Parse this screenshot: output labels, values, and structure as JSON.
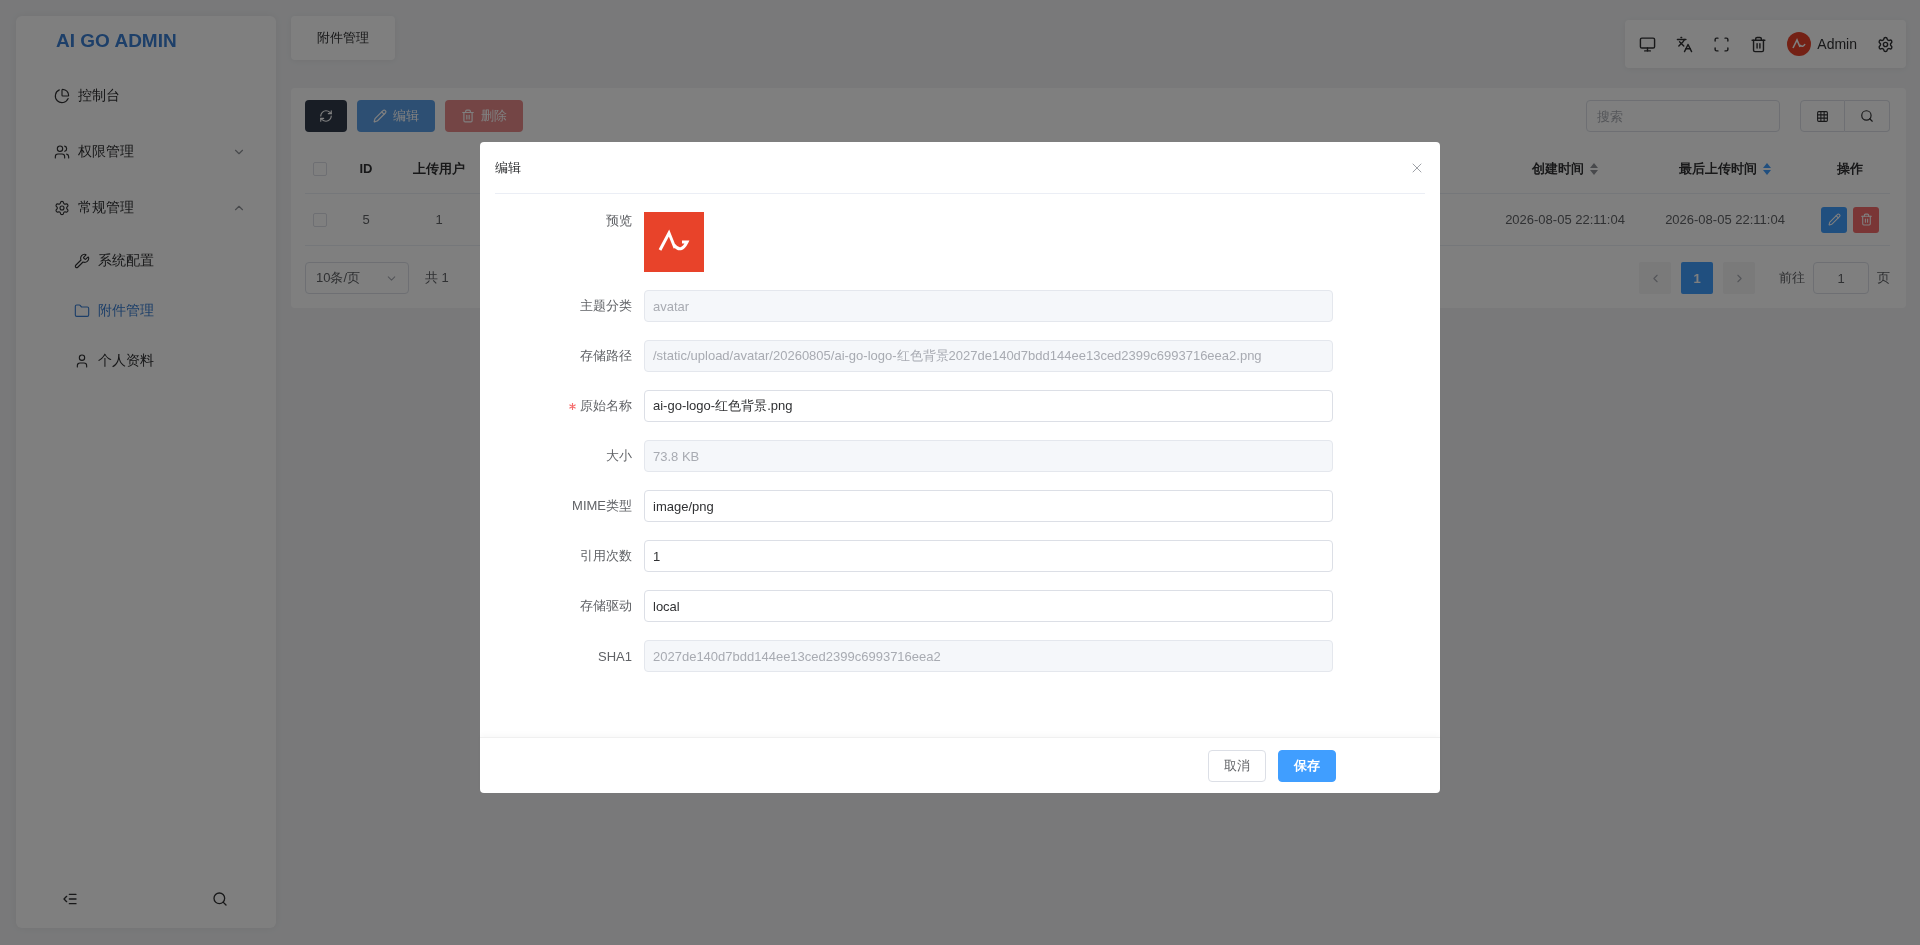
{
  "sidebar": {
    "brand": "AI GO ADMIN",
    "items": [
      {
        "label": "控制台",
        "selected": false
      },
      {
        "label": "权限管理",
        "expanded": false
      },
      {
        "label": "常规管理",
        "expanded": true,
        "children": [
          {
            "label": "系统配置",
            "selected": false
          },
          {
            "label": "附件管理",
            "selected": true
          },
          {
            "label": "个人资料",
            "selected": false
          }
        ]
      }
    ]
  },
  "tabs": [
    {
      "label": "附件管理",
      "selected": true
    }
  ],
  "header": {
    "user": "Admin"
  },
  "toolbar": {
    "buttons": [
      {
        "kind": "refresh",
        "disabled": false
      },
      {
        "kind": "edit",
        "label": "编辑",
        "disabled": true
      },
      {
        "kind": "delete",
        "label": "删除",
        "disabled": true
      }
    ],
    "search": {
      "placeholder": "搜索"
    }
  },
  "table": {
    "columns": [
      {
        "label": "ID"
      },
      {
        "label": "上传用户"
      },
      {
        "label": "创建时间",
        "sorted": false
      },
      {
        "label": "最后上传时间",
        "sorted": true
      },
      {
        "label": "操作"
      }
    ],
    "header_checked": false,
    "rows": [
      {
        "checked": false,
        "cells": [
          "5",
          "1",
          "2026-08-05 22:11:04",
          "2026-08-05 22:11:04"
        ]
      }
    ]
  },
  "pagination": {
    "page_size": "10条/页",
    "total": "共 1",
    "pages": [
      {
        "label": "1",
        "selected": true
      }
    ],
    "goto_label": "前往",
    "goto_value": "1",
    "suffix": "页"
  },
  "dialog": {
    "title": "编辑",
    "fields": [
      {
        "kind": "image",
        "label": "预览"
      },
      {
        "kind": "input",
        "label": "主题分类",
        "value": "avatar",
        "disabled": true
      },
      {
        "kind": "input",
        "label": "存储路径",
        "value": "/static/upload/avatar/20260805/ai-go-logo-红色背景2027de140d7bdd144ee13ced2399c6993716eea2.png",
        "disabled": true
      },
      {
        "kind": "input",
        "label": "原始名称",
        "value": "ai-go-logo-红色背景.png",
        "disabled": false,
        "required": true
      },
      {
        "kind": "input",
        "label": "大小",
        "value": "73.8 KB",
        "disabled": true
      },
      {
        "kind": "input",
        "label": "MIME类型",
        "value": "image/png",
        "disabled": false
      },
      {
        "kind": "input",
        "label": "引用次数",
        "value": "1",
        "disabled": false
      },
      {
        "kind": "input",
        "label": "存储驱动",
        "value": "local",
        "disabled": false
      },
      {
        "kind": "input",
        "label": "SHA1",
        "value": "2027de140d7bdd144ee13ced2399c6993716eea2",
        "disabled": true
      }
    ],
    "buttons": [
      {
        "kind": "cancel",
        "label": "取消"
      },
      {
        "kind": "primary",
        "label": "保存"
      }
    ]
  }
}
